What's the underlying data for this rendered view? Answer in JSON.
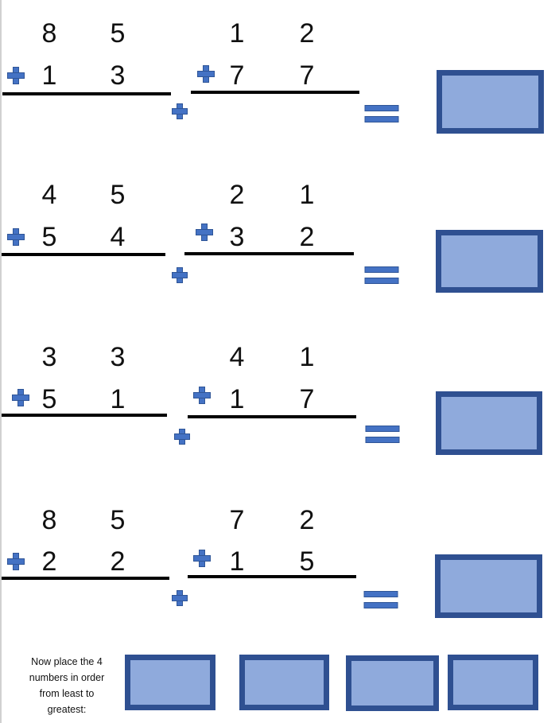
{
  "problems": [
    {
      "a": [
        "8",
        "5"
      ],
      "b": [
        "1",
        "3"
      ],
      "c": [
        "1",
        "2"
      ],
      "d": [
        "7",
        "7"
      ]
    },
    {
      "a": [
        "4",
        "5"
      ],
      "b": [
        "5",
        "4"
      ],
      "c": [
        "2",
        "1"
      ],
      "d": [
        "3",
        "2"
      ]
    },
    {
      "a": [
        "3",
        "3"
      ],
      "b": [
        "5",
        "1"
      ],
      "c": [
        "4",
        "1"
      ],
      "d": [
        "1",
        "7"
      ]
    },
    {
      "a": [
        "8",
        "5"
      ],
      "b": [
        "2",
        "2"
      ],
      "c": [
        "7",
        "2"
      ],
      "d": [
        "1",
        "5"
      ]
    }
  ],
  "instruction": "Now place the 4 numbers in order from least to greatest:",
  "colors": {
    "box_fill": "#8FAADC",
    "box_border": "#2F5091",
    "symbol": "#4472C4"
  }
}
